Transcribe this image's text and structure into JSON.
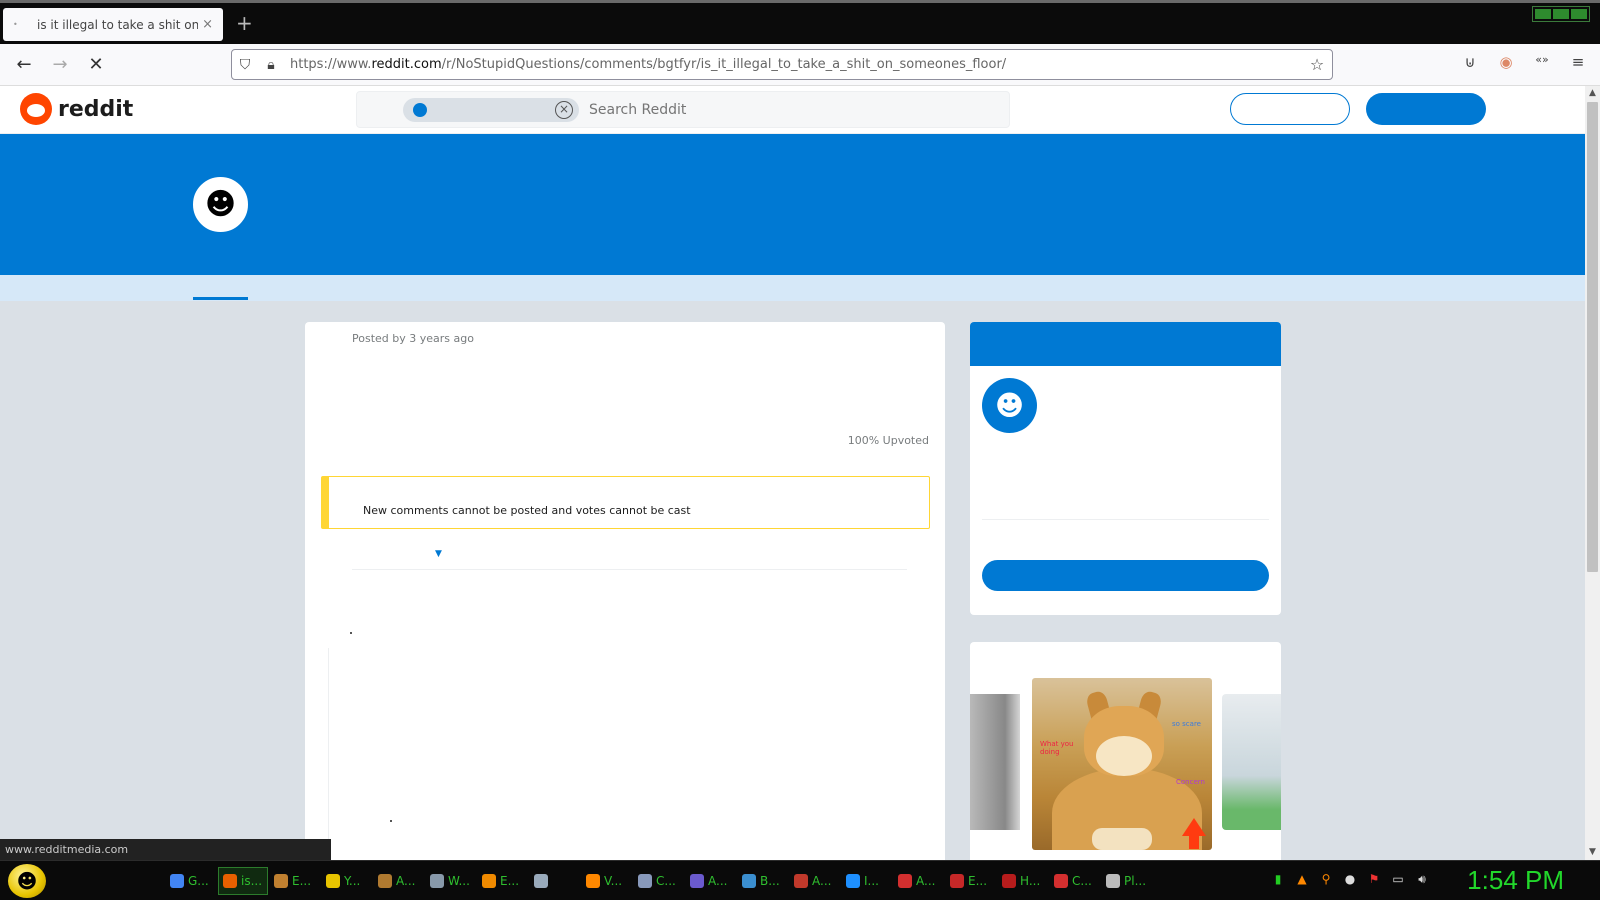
{
  "browser": {
    "tab_title": "is it illegal to take a shit on som",
    "tab_close": "×",
    "new_tab": "+",
    "url_prefix": "https://www.",
    "url_domain": "reddit.com",
    "url_path": "/r/NoStupidQuestions/comments/bgtfyr/is_it_illegal_to_take_a_shit_on_someones_floor/"
  },
  "reddit": {
    "logo_text": "reddit",
    "search_placeholder": "Search Reddit",
    "post_meta": "Posted by 3 years ago",
    "upvote_ratio": "100% Upvoted",
    "archived_notice": "New comments cannot be posted and votes cannot be cast"
  },
  "status_url": "www.redditmedia.com",
  "carousel": {
    "caption_1": "so scare",
    "caption_2": "What you doing",
    "caption_3": "Concern"
  },
  "taskbar": {
    "tasks": [
      {
        "label": "G...",
        "color": "#4285f4"
      },
      {
        "label": "is...",
        "color": "#e66000",
        "active": true
      },
      {
        "label": "E...",
        "color": "#c08030"
      },
      {
        "label": "Y...",
        "color": "#e8c400"
      },
      {
        "label": "A...",
        "color": "#b07a30"
      },
      {
        "label": "W...",
        "color": "#8899aa"
      },
      {
        "label": "E...",
        "color": "#f08a00"
      },
      {
        "label": "",
        "color": "#9ab"
      },
      {
        "label": "V...",
        "color": "#ff8800"
      },
      {
        "label": "C...",
        "color": "#8899bb"
      },
      {
        "label": "A...",
        "color": "#6a5acd"
      },
      {
        "label": "B...",
        "color": "#3b8fd0"
      },
      {
        "label": "A...",
        "color": "#c0392b"
      },
      {
        "label": "I...",
        "color": "#1e90ff"
      },
      {
        "label": "A...",
        "color": "#d32f2f"
      },
      {
        "label": "E...",
        "color": "#c62828"
      },
      {
        "label": "H...",
        "color": "#b71c1c"
      },
      {
        "label": "C...",
        "color": "#d32f2f"
      },
      {
        "label": "Pl...",
        "color": "#bbb"
      }
    ],
    "clock": "1:54 PM"
  }
}
